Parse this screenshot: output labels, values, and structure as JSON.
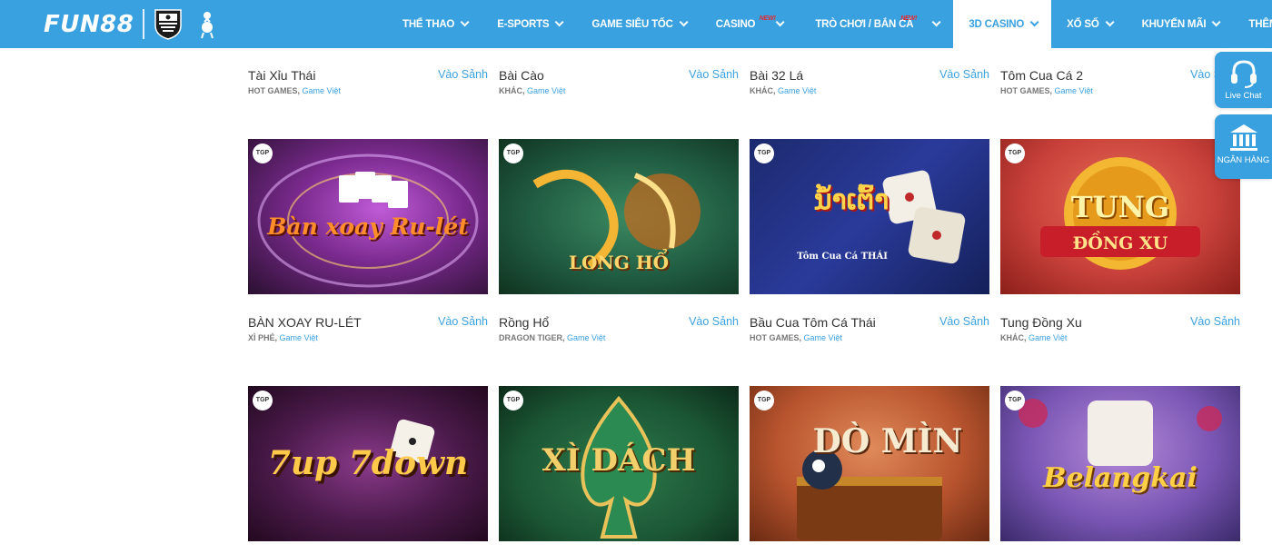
{
  "header": {
    "logo": "FUN88",
    "nav": [
      {
        "label": "THỂ THAO",
        "new": ""
      },
      {
        "label": "E-SPORTS",
        "new": ""
      },
      {
        "label": "GAME SIÊU TỐC",
        "new": ""
      },
      {
        "label": "CASINO",
        "new": "NEW!"
      },
      {
        "label": "TRÒ CHƠI / BẮN CÁ",
        "new": "NEW!"
      },
      {
        "label": "3D CASINO",
        "new": "",
        "active": true
      },
      {
        "label": "XỔ SỐ",
        "new": ""
      },
      {
        "label": "KHUYẾN MÃI",
        "new": ""
      },
      {
        "label": "THÊM",
        "new": ""
      }
    ]
  },
  "side": {
    "live_chat": "Live Chat",
    "bank": "NGÂN HÀNG"
  },
  "lobby_label": "Vào Sảnh",
  "tgp_badge": "TGP",
  "row1": [
    {
      "name": "Tài Xỉu Thái",
      "category": "HOT GAMES,",
      "tag": "Game Việt"
    },
    {
      "name": "Bài Cào",
      "category": "KHÁC,",
      "tag": "Game Việt"
    },
    {
      "name": "Bài 32 Lá",
      "category": "KHÁC,",
      "tag": "Game Việt"
    },
    {
      "name": "Tôm Cua Cá 2",
      "category": "HOT GAMES,",
      "tag": "Game Việt"
    }
  ],
  "row2": [
    {
      "name": "BÀN XOAY RU-LÉT",
      "category": "XÌ PHÉ,",
      "tag": "Game Việt",
      "art": "Bàn xoay Ru-lét"
    },
    {
      "name": "Rồng Hổ",
      "category": "DRAGON TIGER,",
      "tag": "Game Việt",
      "art": "LONG HỔ"
    },
    {
      "name": "Bầu Cua Tôm Cá Thái",
      "category": "HOT GAMES,",
      "tag": "Game Việt",
      "art": "Tôm Cua Cá THÁI"
    },
    {
      "name": "Tung Đồng Xu",
      "category": "KHÁC,",
      "tag": "Game Việt",
      "art": "TUNG",
      "art2": "ĐỒNG XU"
    }
  ],
  "row3": [
    {
      "art": "7up 7down"
    },
    {
      "art": "XÌ DÁCH"
    },
    {
      "art": "DÒ MÌN"
    },
    {
      "art": "Belangkai"
    }
  ],
  "colors": {
    "brand_blue": "#3aa1e0",
    "new_red": "#e8262b"
  }
}
